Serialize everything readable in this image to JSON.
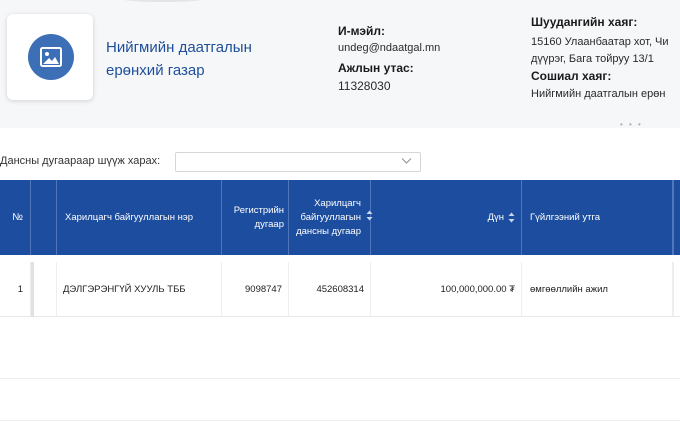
{
  "org": {
    "name": "Нийгмийн даатгалын ерөнхий газар"
  },
  "contact": {
    "email_label": "И-мэйл:",
    "email": "undeg@ndaatgal.mn",
    "phone_label": "Ажлын утас:",
    "phone": "11328030"
  },
  "address": {
    "label": "Шуудангийн хаяг:",
    "line1": "15160 Улаанбаатар хот, Чи",
    "line2": "дүүрэг, Бага тойруу 13/1"
  },
  "social": {
    "label": "Сошиал хаяг:",
    "value": "Нийгмийн даатгалын ерөн"
  },
  "filter": {
    "label": "Дансны дугаараар шүүж харах:",
    "selected": ""
  },
  "table": {
    "headers": {
      "num": "№",
      "partner": "Харилцагч байгууллагын нэр",
      "register": "Регистрийн дугаар",
      "account": "Харилцагч байгууллагын дансны дугаар",
      "amount": "Дүн",
      "purpose": "Гүйлгээний утга"
    },
    "rows": [
      {
        "num": "1",
        "partner": "ДЭЛГЭРЭНГҮЙ ХУУЛЬ ТББ",
        "register": "9098747",
        "account": "452608314",
        "amount": "100,000,000.00 ₮",
        "purpose": "өмгөөллийн ажил"
      }
    ]
  },
  "colors": {
    "header_bg": "#1c4d9f",
    "brand_text": "#1f4f9a",
    "logo": "#3c6fb5"
  }
}
